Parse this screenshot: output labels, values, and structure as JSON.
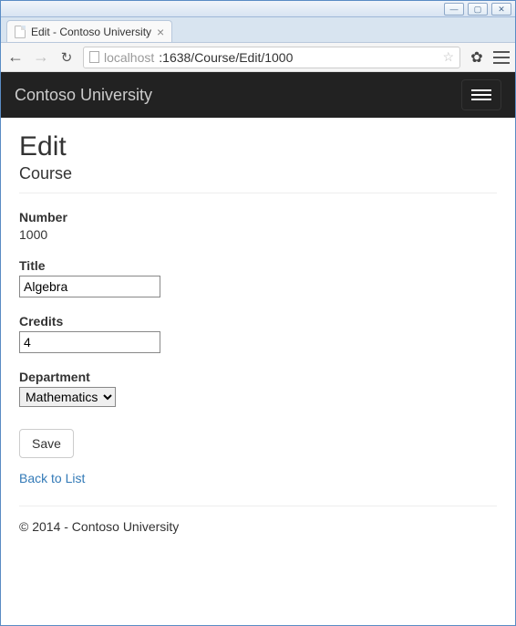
{
  "window": {
    "min": "—",
    "max": "▢",
    "close": "✕"
  },
  "browser": {
    "tab_title": "Edit - Contoso University",
    "url_host": "localhost",
    "url_port_path": ":1638/Course/Edit/1000"
  },
  "navbar": {
    "brand": "Contoso University"
  },
  "page": {
    "title": "Edit",
    "subtitle": "Course"
  },
  "form": {
    "number": {
      "label": "Number",
      "value": "1000"
    },
    "title": {
      "label": "Title",
      "value": "Algebra"
    },
    "credits": {
      "label": "Credits",
      "value": "4"
    },
    "department": {
      "label": "Department",
      "selected": "Mathematics"
    },
    "save_label": "Save"
  },
  "links": {
    "back": "Back to List"
  },
  "footer": {
    "text": "© 2014 - Contoso University"
  }
}
